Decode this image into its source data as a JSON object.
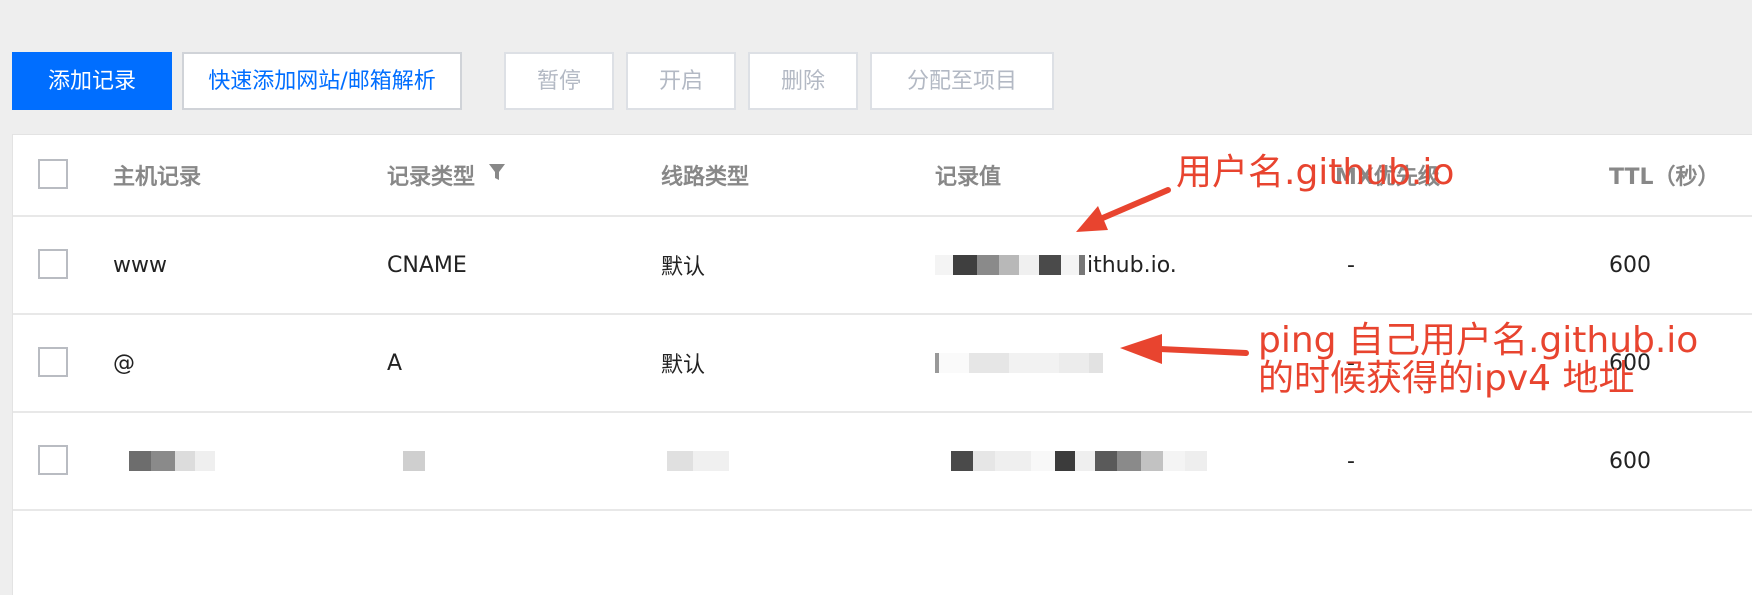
{
  "toolbar": {
    "add_record": "添加记录",
    "quick_add": "快速添加网站/邮箱解析",
    "pause": "暂停",
    "enable": "开启",
    "delete": "删除",
    "assign_project": "分配至项目"
  },
  "table": {
    "headers": {
      "host": "主机记录",
      "type": "记录类型",
      "line": "线路类型",
      "value": "记录值",
      "mx": "MX优先级",
      "ttl": "TTL（秒）"
    },
    "rows": [
      {
        "host": "www",
        "type": "CNAME",
        "line": "默认",
        "value": "ithub.io.",
        "mx": "-",
        "ttl": "600"
      },
      {
        "host": "@",
        "type": "A",
        "line": "默认",
        "value": "",
        "mx": "-",
        "ttl": "600"
      },
      {
        "host": "",
        "type": "",
        "line": "",
        "value": "",
        "mx": "-",
        "ttl": "600"
      }
    ]
  },
  "annotations": {
    "top": "用户名.github.io",
    "bottom_line1": "ping 自己用户名.github.io",
    "bottom_line2": "的时候获得的ipv4 地址"
  },
  "colors": {
    "primary": "#006eff",
    "annotation": "#e8442f"
  }
}
